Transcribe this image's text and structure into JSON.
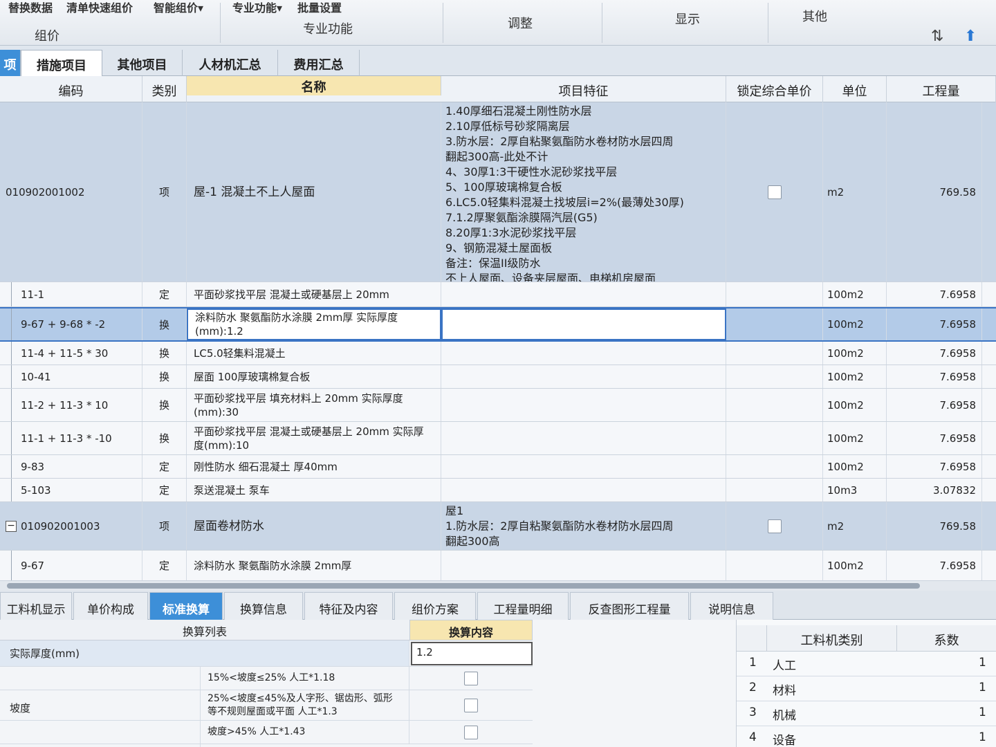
{
  "ribbon": {
    "toolbar_items": [
      "替换数据",
      "清单快速组价",
      "智能组价▾",
      "专业功能▾",
      "批量设置"
    ],
    "groups": [
      "组价",
      "专业功能",
      "调整",
      "显示",
      "其他"
    ],
    "icons": [
      "sort-icon",
      "up-arrow-icon"
    ]
  },
  "tabs": [
    "项",
    "措施项目",
    "其他项目",
    "人材机汇总",
    "费用汇总"
  ],
  "grid": {
    "headers": {
      "code": "编码",
      "category": "类别",
      "name": "名称",
      "features": "项目特征",
      "lock": "锁定综合单价",
      "unit": "单位",
      "quantity": "工程量"
    },
    "rows": [
      {
        "code": "010902001002",
        "category": "项",
        "name": "屋-1 混凝土不上人屋面",
        "features": "1.40厚细石混凝土刚性防水层\n2.10厚低标号砂浆隔离层\n3.防水层：2厚自粘聚氨酯防水卷材防水层四周\n翻起300高-此处不计\n4、30厚1:3干硬性水泥砂浆找平层\n5、100厚玻璃棉复合板\n6.LC5.0轻集料混凝土找坡层i=2%(最薄处30厚)\n7.1.2厚聚氨酯涂膜隔汽层(G5)\n8.20厚1:3水泥砂浆找平层\n9、钢筋混凝土屋面板\n备注：保温II级防水\n不上人屋面、设备夹层屋面、电梯机房屋面",
        "unit": "m2",
        "quantity": "769.58"
      },
      {
        "code": "11-1",
        "category": "定",
        "name": "平面砂浆找平层 混凝土或硬基层上 20mm",
        "features": "",
        "unit": "100m2",
        "quantity": "7.6958"
      },
      {
        "code": "9-67 + 9-68 * -2",
        "category": "换",
        "name": "涂料防水 聚氨酯防水涂膜 2mm厚 实际厚度(mm):1.2",
        "features": "",
        "unit": "100m2",
        "quantity": "7.6958"
      },
      {
        "code": "11-4 + 11-5 * 30",
        "category": "换",
        "name": "LC5.0轻集料混凝土",
        "features": "",
        "unit": "100m2",
        "quantity": "7.6958"
      },
      {
        "code": "10-41",
        "category": "换",
        "name": "屋面 100厚玻璃棉复合板",
        "features": "",
        "unit": "100m2",
        "quantity": "7.6958"
      },
      {
        "code": "11-2 + 11-3 * 10",
        "category": "换",
        "name": "平面砂浆找平层 填充材料上 20mm 实际厚度(mm):30",
        "features": "",
        "unit": "100m2",
        "quantity": "7.6958"
      },
      {
        "code": "11-1 + 11-3 * -10",
        "category": "换",
        "name": "平面砂浆找平层 混凝土或硬基层上 20mm 实际厚度(mm):10",
        "features": "",
        "unit": "100m2",
        "quantity": "7.6958"
      },
      {
        "code": "9-83",
        "category": "定",
        "name": "刚性防水 细石混凝土 厚40mm",
        "features": "",
        "unit": "100m2",
        "quantity": "7.6958"
      },
      {
        "code": "5-103",
        "category": "定",
        "name": "泵送混凝土 泵车",
        "features": "",
        "unit": "10m3",
        "quantity": "3.07832"
      },
      {
        "code": "010902001003",
        "category": "项",
        "name": "屋面卷材防水",
        "features": "屋1\n1.防水层：2厚自粘聚氨酯防水卷材防水层四周\n翻起300高",
        "unit": "m2",
        "quantity": "769.58"
      },
      {
        "code": "9-67",
        "category": "定",
        "name": "涂料防水 聚氨酯防水涂膜 2mm厚",
        "features": "",
        "unit": "100m2",
        "quantity": "7.6958"
      }
    ]
  },
  "bottom_tabs": [
    "工料机显示",
    "单价构成",
    "标准换算",
    "换算信息",
    "特征及内容",
    "组价方案",
    "工程量明细",
    "反查图形工程量",
    "说明信息"
  ],
  "conversion": {
    "list_header": "换算列表",
    "content_header": "换算内容",
    "thickness_label": "实际厚度(mm)",
    "thickness_value": "1.2",
    "slope_label": "坡度",
    "slope_options": [
      "15%<坡度≤25% 人工*1.18",
      "25%<坡度≤45%及人字形、锯齿形、弧形等不规则屋面或平面 人工*1.3",
      "坡度>45% 人工*1.43"
    ]
  },
  "coef_table": {
    "headers": {
      "category": "工料机类别",
      "coef": "系数"
    },
    "rows": [
      {
        "no": "1",
        "category": "人工",
        "coef": "1"
      },
      {
        "no": "2",
        "category": "材料",
        "coef": "1"
      },
      {
        "no": "3",
        "category": "机械",
        "coef": "1"
      },
      {
        "no": "4",
        "category": "设备",
        "coef": "1"
      }
    ]
  }
}
